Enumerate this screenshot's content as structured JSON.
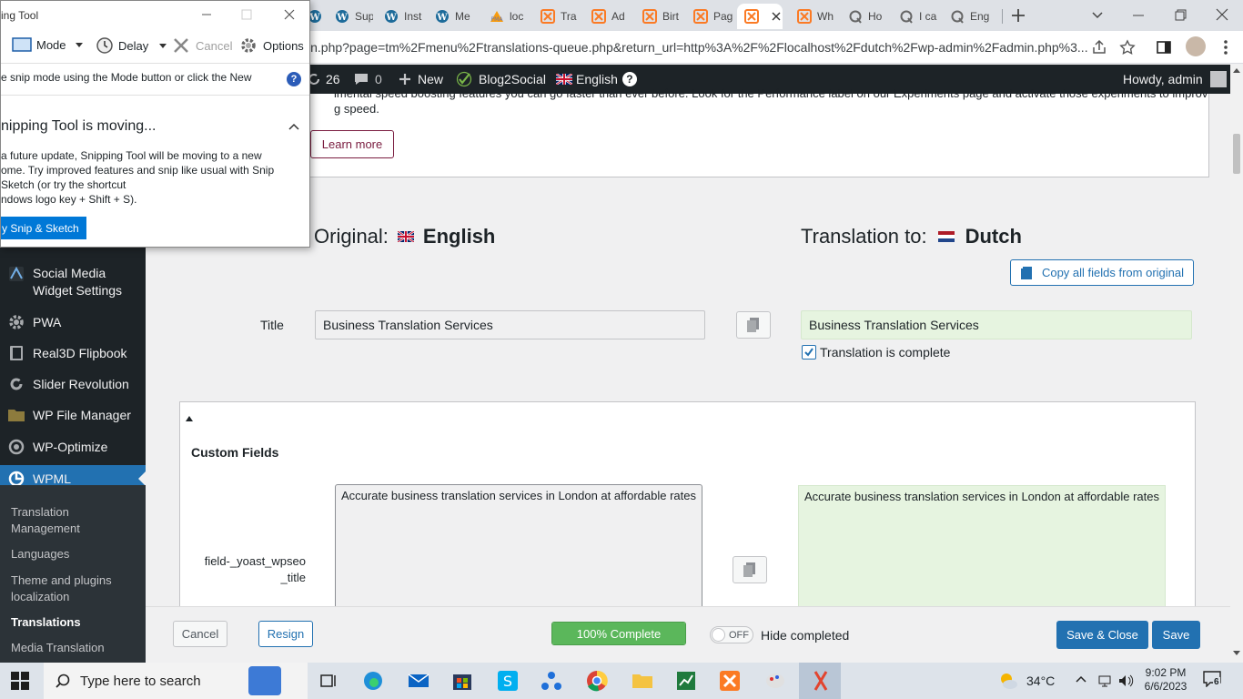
{
  "browser": {
    "tabs": [
      {
        "label": "e",
        "icon": "wordpress-icon"
      },
      {
        "label": "Sup",
        "icon": "wordpress-icon"
      },
      {
        "label": "Inst",
        "icon": "wordpress-icon"
      },
      {
        "label": "Me",
        "icon": "wordpress-icon"
      },
      {
        "label": "loc",
        "icon": "phpmyadmin-icon"
      },
      {
        "label": "Tra",
        "icon": "xampp-icon"
      },
      {
        "label": "Ad",
        "icon": "xampp-icon"
      },
      {
        "label": "Birt",
        "icon": "xampp-icon"
      },
      {
        "label": "Pag",
        "icon": "xampp-icon"
      },
      {
        "label": "",
        "icon": "xampp-icon"
      },
      {
        "label": "Wh",
        "icon": "xampp-icon"
      },
      {
        "label": "Ho",
        "icon": "quora-icon"
      },
      {
        "label": "I ca",
        "icon": "quora-icon"
      },
      {
        "label": "Eng",
        "icon": "quora-icon"
      }
    ],
    "url": "in.php?page=tm%2Fmenu%2Ftranslations-queue.php&return_url=http%3A%2F%2Flocalhost%2Fdutch%2Fwp-admin%2Fadmin.php%3..."
  },
  "adminbar": {
    "comments_count": "26",
    "pending_count": "0",
    "new_label": "New",
    "blog2social_label": "Blog2Social",
    "language_label": "English",
    "howdy": "Howdy, admin"
  },
  "notice": {
    "line1": "imental speed boosting features you can go faster than ever before. Look for the Performance label on our Experiments page and activate those experiments to improve",
    "line2": "g speed.",
    "learn_more": "Learn more"
  },
  "sidebar": {
    "items": [
      {
        "label": "Social Media Widget Settings",
        "icon": "social-icon"
      },
      {
        "label": "PWA",
        "icon": "gear-icon"
      },
      {
        "label": "Real3D Flipbook",
        "icon": "book-icon"
      },
      {
        "label": "Slider Revolution",
        "icon": "refresh-icon"
      },
      {
        "label": "WP File Manager",
        "icon": "folder-icon"
      },
      {
        "label": "WP-Optimize",
        "icon": "optimize-icon"
      },
      {
        "label": "WPML",
        "icon": "wpml-icon"
      }
    ],
    "submenu": [
      {
        "label": "Translation Management"
      },
      {
        "label": "Languages"
      },
      {
        "label": "Theme and plugins localization"
      },
      {
        "label": "Translations"
      },
      {
        "label": "Media Translation"
      }
    ]
  },
  "editor": {
    "original_label": "Original:",
    "original_language": "English",
    "translation_label": "Translation to:",
    "translation_language": "Dutch",
    "copy_all": "Copy all fields from original",
    "title_label": "Title",
    "title_original": "Business Translation Services",
    "title_translation": "Business Translation Services",
    "complete_label": "Translation is complete",
    "custom_fields_heading": "Custom Fields",
    "field_name": "field-_yoast_wpseo _title",
    "field_original": "Accurate business translation services in London at affordable rates",
    "field_translation": "Accurate business translation services in London at affordable rates"
  },
  "footer": {
    "cancel": "Cancel",
    "resign": "Resign",
    "progress_label": "100% Complete",
    "progress_value": 100,
    "toggle_label": "OFF",
    "hide_completed": "Hide completed",
    "save_close": "Save & Close",
    "save": "Save"
  },
  "snipping_tool": {
    "title": "ing Tool",
    "mode": "Mode",
    "delay": "Delay",
    "cancel": "Cancel",
    "options": "Options",
    "hint": "e snip mode using the Mode button or click the New",
    "heading": "nipping Tool is moving...",
    "body_lines": [
      "a future update, Snipping Tool will be moving to a new",
      "ome. Try improved features and snip like usual with Snip",
      "Sketch (or try the shortcut",
      "ndows logo key + Shift + S)."
    ],
    "try_button": "y Snip & Sketch"
  },
  "taskbar": {
    "search_placeholder": "Type here to search",
    "weather": "34°C",
    "time": "9:02 PM",
    "date": "6/6/2023",
    "notifications": "6"
  },
  "colors": {
    "accent": "#2271b1",
    "admin_bar": "#1d2327",
    "progress_green": "#5bb75b",
    "translated_bg": "#e6f4e0"
  }
}
